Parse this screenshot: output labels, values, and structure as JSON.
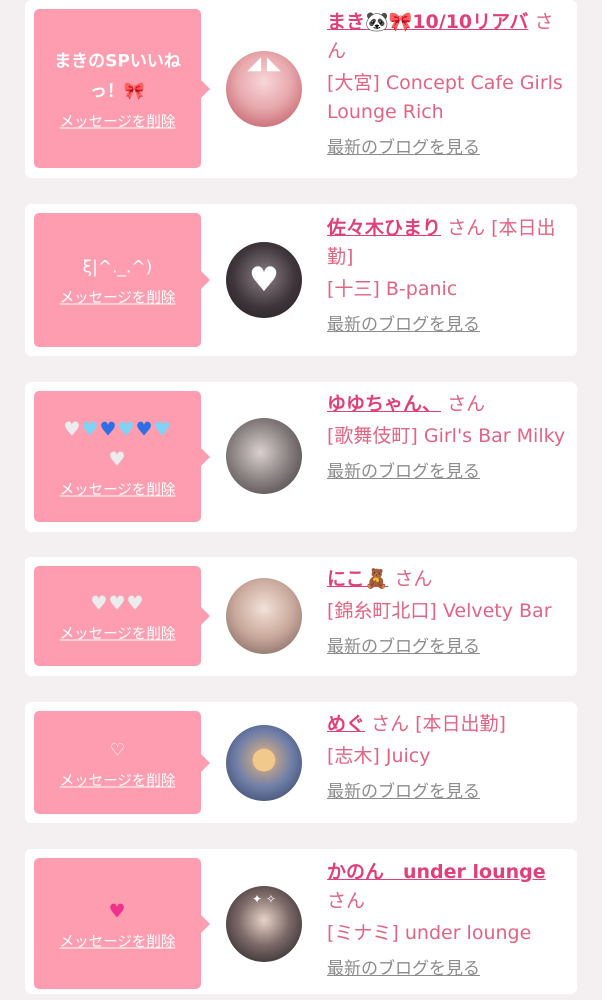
{
  "delete_label": "メッセージを削除",
  "blog_label": "最新のブログを見る",
  "honorific": "さん",
  "colors": {
    "page_bg": "#f4f0f1",
    "bubble_bg": "#fe9db0",
    "name": "#e0407a",
    "shop": "#e26483",
    "blog_link": "#8c8c8c"
  },
  "cards": [
    {
      "message": "まきのSPいいねっ！🎀",
      "name": "まき🐼🎀10/10リアバ",
      "status": "",
      "shop": "[大宮] Concept Cafe Girls Lounge Rich",
      "avatar": "cat-ear-girl-photo"
    },
    {
      "message": "ξ|^._.^)",
      "name": "佐々木ひまり",
      "status": "[本日出勤]",
      "shop": "[十三] B-panic",
      "avatar": "heart-covered-face-photo"
    },
    {
      "message": "🤍🩵💙🩵💙🩵🤍",
      "name": "ゆゆちゃん、",
      "status": "",
      "shop": "[歌舞伎町] Girl's Bar Milky",
      "avatar": "selfie-photo"
    },
    {
      "message": "🤍🤍🤍",
      "name": "にこ🧸",
      "status": "",
      "shop": "[錦糸町北口] Velvety Bar",
      "avatar": "peace-sign-photo"
    },
    {
      "message": "♡",
      "name": "めぐ",
      "status": "[本日出勤]",
      "shop": "[志木] Juicy",
      "avatar": "bear-sticker-photo"
    },
    {
      "message": "💗",
      "name": "かのん　under lounge",
      "status": "",
      "shop": "[ミナミ] under lounge",
      "avatar": "night-photo"
    }
  ]
}
